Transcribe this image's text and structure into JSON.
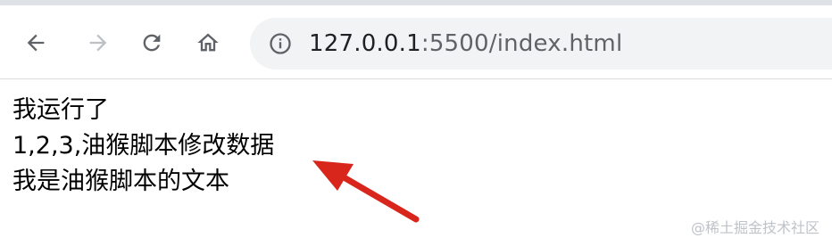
{
  "browser": {
    "address_bar": {
      "host": "127.0.0.1",
      "path": ":5500/index.html"
    },
    "icons": {
      "back": "arrow-left-icon",
      "forward": "arrow-right-icon",
      "reload": "reload-icon",
      "home": "home-icon",
      "site_info": "info-circle-icon"
    }
  },
  "page": {
    "lines": [
      "我运行了",
      "1,2,3,油猴脚本修改数据",
      "我是油猴脚本的文本"
    ]
  },
  "annotation": {
    "arrow_color": "#d9261c"
  },
  "watermark": {
    "text": "@稀土掘金技术社区"
  }
}
